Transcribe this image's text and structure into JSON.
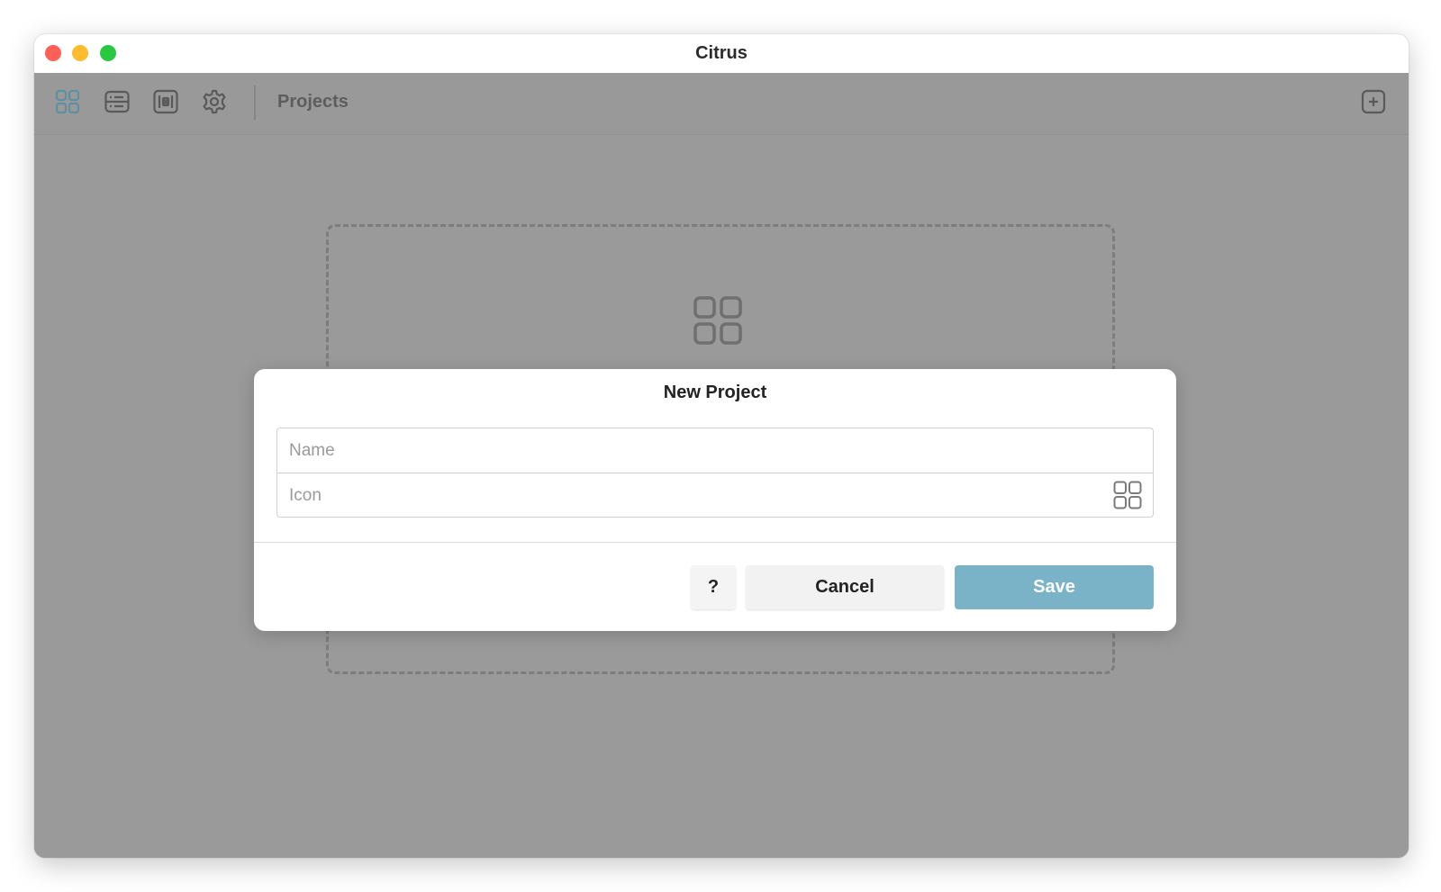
{
  "window": {
    "title": "Citrus"
  },
  "toolbar": {
    "title": "Projects",
    "icons": [
      "grid-icon",
      "list-icon",
      "frame-icon",
      "gear-icon"
    ],
    "add_icon": "plus-square-icon",
    "accent_color": "#5e8fa3"
  },
  "empty_state": {
    "icon": "grid-icon"
  },
  "modal": {
    "title": "New Project",
    "name_placeholder": "Name",
    "name_value": "",
    "icon_placeholder": "Icon",
    "icon_value": "",
    "icon_picker": "grid-icon",
    "help_label": "?",
    "cancel_label": "Cancel",
    "save_label": "Save",
    "save_color": "#7ab3c8"
  }
}
